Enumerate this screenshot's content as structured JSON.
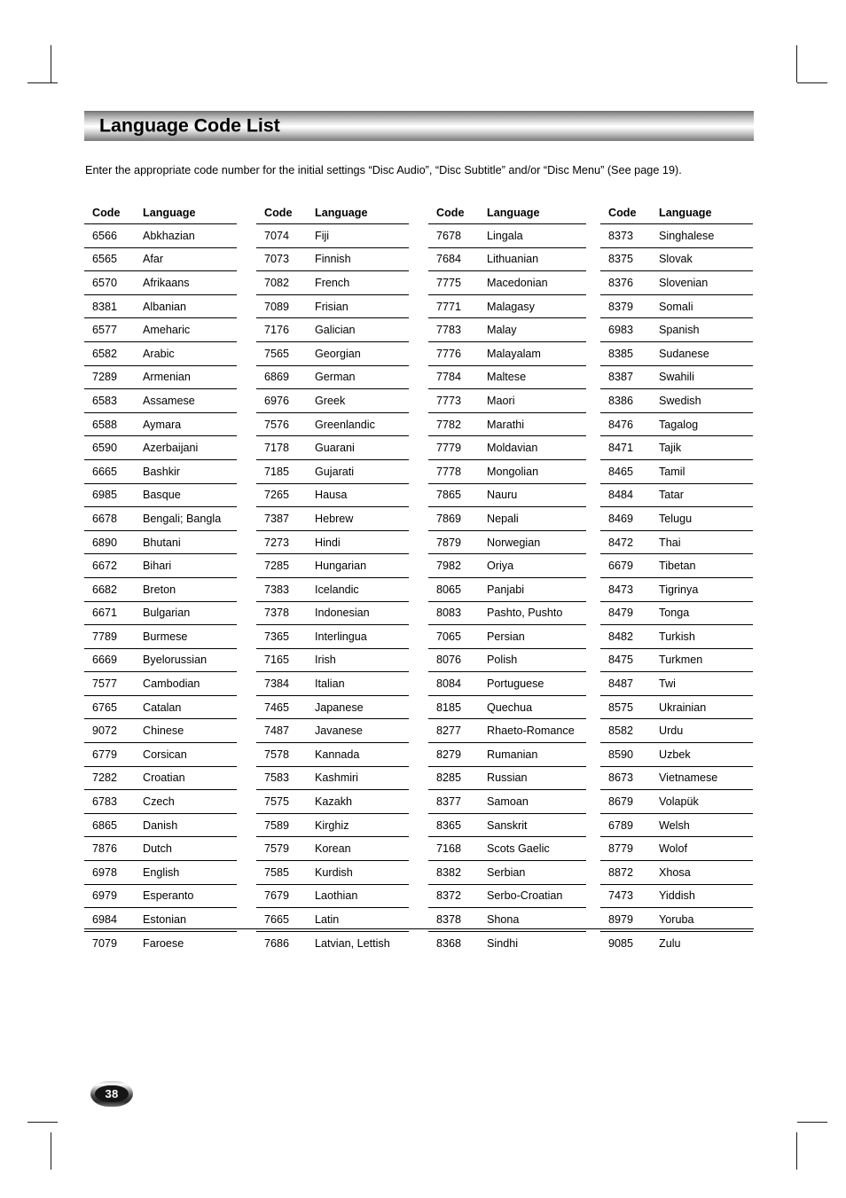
{
  "document": {
    "title": "Language Code List",
    "intro": "Enter the appropriate code number for the initial settings “Disc Audio”, “Disc Subtitle” and/or “Disc Menu” (See page 19).",
    "page_number": "38"
  },
  "table": {
    "headers": {
      "code": "Code",
      "language": "Language"
    },
    "columns": [
      {
        "rows": [
          {
            "code": "6566",
            "language": "Abkhazian"
          },
          {
            "code": "6565",
            "language": "Afar"
          },
          {
            "code": "6570",
            "language": "Afrikaans"
          },
          {
            "code": "8381",
            "language": "Albanian"
          },
          {
            "code": "6577",
            "language": "Ameharic"
          },
          {
            "code": "6582",
            "language": "Arabic"
          },
          {
            "code": "7289",
            "language": "Armenian"
          },
          {
            "code": "6583",
            "language": "Assamese"
          },
          {
            "code": "6588",
            "language": "Aymara"
          },
          {
            "code": "6590",
            "language": "Azerbaijani"
          },
          {
            "code": "6665",
            "language": "Bashkir"
          },
          {
            "code": "6985",
            "language": "Basque"
          },
          {
            "code": "6678",
            "language": "Bengali; Bangla"
          },
          {
            "code": "6890",
            "language": "Bhutani"
          },
          {
            "code": "6672",
            "language": "Bihari"
          },
          {
            "code": "6682",
            "language": "Breton"
          },
          {
            "code": "6671",
            "language": "Bulgarian"
          },
          {
            "code": "7789",
            "language": "Burmese"
          },
          {
            "code": "6669",
            "language": "Byelorussian"
          },
          {
            "code": "7577",
            "language": "Cambodian"
          },
          {
            "code": "6765",
            "language": "Catalan"
          },
          {
            "code": "9072",
            "language": "Chinese"
          },
          {
            "code": "6779",
            "language": "Corsican"
          },
          {
            "code": "7282",
            "language": "Croatian"
          },
          {
            "code": "6783",
            "language": "Czech"
          },
          {
            "code": "6865",
            "language": "Danish"
          },
          {
            "code": "7876",
            "language": "Dutch"
          },
          {
            "code": "6978",
            "language": "English"
          },
          {
            "code": "6979",
            "language": "Esperanto"
          },
          {
            "code": "6984",
            "language": "Estonian"
          },
          {
            "code": "7079",
            "language": "Faroese"
          }
        ]
      },
      {
        "rows": [
          {
            "code": "7074",
            "language": "Fiji"
          },
          {
            "code": "7073",
            "language": "Finnish"
          },
          {
            "code": "7082",
            "language": "French"
          },
          {
            "code": "7089",
            "language": "Frisian"
          },
          {
            "code": "7176",
            "language": "Galician"
          },
          {
            "code": "7565",
            "language": "Georgian"
          },
          {
            "code": "6869",
            "language": "German"
          },
          {
            "code": "6976",
            "language": "Greek"
          },
          {
            "code": "7576",
            "language": "Greenlandic"
          },
          {
            "code": "7178",
            "language": "Guarani"
          },
          {
            "code": "7185",
            "language": "Gujarati"
          },
          {
            "code": "7265",
            "language": "Hausa"
          },
          {
            "code": "7387",
            "language": "Hebrew"
          },
          {
            "code": "7273",
            "language": "Hindi"
          },
          {
            "code": "7285",
            "language": "Hungarian"
          },
          {
            "code": "7383",
            "language": "Icelandic"
          },
          {
            "code": "7378",
            "language": "Indonesian"
          },
          {
            "code": "7365",
            "language": "Interlingua"
          },
          {
            "code": "7165",
            "language": "Irish"
          },
          {
            "code": "7384",
            "language": "Italian"
          },
          {
            "code": "7465",
            "language": "Japanese"
          },
          {
            "code": "7487",
            "language": "Javanese"
          },
          {
            "code": "7578",
            "language": "Kannada"
          },
          {
            "code": "7583",
            "language": "Kashmiri"
          },
          {
            "code": "7575",
            "language": "Kazakh"
          },
          {
            "code": "7589",
            "language": "Kirghiz"
          },
          {
            "code": "7579",
            "language": "Korean"
          },
          {
            "code": "7585",
            "language": "Kurdish"
          },
          {
            "code": "7679",
            "language": "Laothian"
          },
          {
            "code": "7665",
            "language": "Latin"
          },
          {
            "code": "7686",
            "language": "Latvian, Lettish"
          }
        ]
      },
      {
        "rows": [
          {
            "code": "7678",
            "language": "Lingala"
          },
          {
            "code": "7684",
            "language": "Lithuanian"
          },
          {
            "code": "7775",
            "language": "Macedonian"
          },
          {
            "code": "7771",
            "language": "Malagasy"
          },
          {
            "code": "7783",
            "language": "Malay"
          },
          {
            "code": "7776",
            "language": "Malayalam"
          },
          {
            "code": "7784",
            "language": "Maltese"
          },
          {
            "code": "7773",
            "language": "Maori"
          },
          {
            "code": "7782",
            "language": "Marathi"
          },
          {
            "code": "7779",
            "language": "Moldavian"
          },
          {
            "code": "7778",
            "language": "Mongolian"
          },
          {
            "code": "7865",
            "language": "Nauru"
          },
          {
            "code": "7869",
            "language": "Nepali"
          },
          {
            "code": "7879",
            "language": "Norwegian"
          },
          {
            "code": "7982",
            "language": "Oriya"
          },
          {
            "code": "8065",
            "language": "Panjabi"
          },
          {
            "code": "8083",
            "language": "Pashto, Pushto"
          },
          {
            "code": "7065",
            "language": "Persian"
          },
          {
            "code": "8076",
            "language": "Polish"
          },
          {
            "code": "8084",
            "language": "Portuguese"
          },
          {
            "code": "8185",
            "language": "Quechua"
          },
          {
            "code": "8277",
            "language": "Rhaeto-Romance"
          },
          {
            "code": "8279",
            "language": "Rumanian"
          },
          {
            "code": "8285",
            "language": "Russian"
          },
          {
            "code": "8377",
            "language": "Samoan"
          },
          {
            "code": "8365",
            "language": "Sanskrit"
          },
          {
            "code": "7168",
            "language": "Scots Gaelic"
          },
          {
            "code": "8382",
            "language": "Serbian"
          },
          {
            "code": "8372",
            "language": "Serbo-Croatian"
          },
          {
            "code": "8378",
            "language": "Shona"
          },
          {
            "code": "8368",
            "language": "Sindhi"
          }
        ]
      },
      {
        "rows": [
          {
            "code": "8373",
            "language": "Singhalese"
          },
          {
            "code": "8375",
            "language": "Slovak"
          },
          {
            "code": "8376",
            "language": "Slovenian"
          },
          {
            "code": "8379",
            "language": "Somali"
          },
          {
            "code": "6983",
            "language": "Spanish"
          },
          {
            "code": "8385",
            "language": "Sudanese"
          },
          {
            "code": "8387",
            "language": "Swahili"
          },
          {
            "code": "8386",
            "language": "Swedish"
          },
          {
            "code": "8476",
            "language": "Tagalog"
          },
          {
            "code": "8471",
            "language": "Tajik"
          },
          {
            "code": "8465",
            "language": "Tamil"
          },
          {
            "code": "8484",
            "language": "Tatar"
          },
          {
            "code": "8469",
            "language": "Telugu"
          },
          {
            "code": "8472",
            "language": "Thai"
          },
          {
            "code": "6679",
            "language": "Tibetan"
          },
          {
            "code": "8473",
            "language": "Tigrinya"
          },
          {
            "code": "8479",
            "language": "Tonga"
          },
          {
            "code": "8482",
            "language": "Turkish"
          },
          {
            "code": "8475",
            "language": "Turkmen"
          },
          {
            "code": "8487",
            "language": "Twi"
          },
          {
            "code": "8575",
            "language": "Ukrainian"
          },
          {
            "code": "8582",
            "language": "Urdu"
          },
          {
            "code": "8590",
            "language": "Uzbek"
          },
          {
            "code": "8673",
            "language": "Vietnamese"
          },
          {
            "code": "8679",
            "language": "Volapük"
          },
          {
            "code": "6789",
            "language": "Welsh"
          },
          {
            "code": "8779",
            "language": "Wolof"
          },
          {
            "code": "8872",
            "language": "Xhosa"
          },
          {
            "code": "7473",
            "language": "Yiddish"
          },
          {
            "code": "8979",
            "language": "Yoruba"
          },
          {
            "code": "9085",
            "language": "Zulu"
          }
        ]
      }
    ]
  }
}
